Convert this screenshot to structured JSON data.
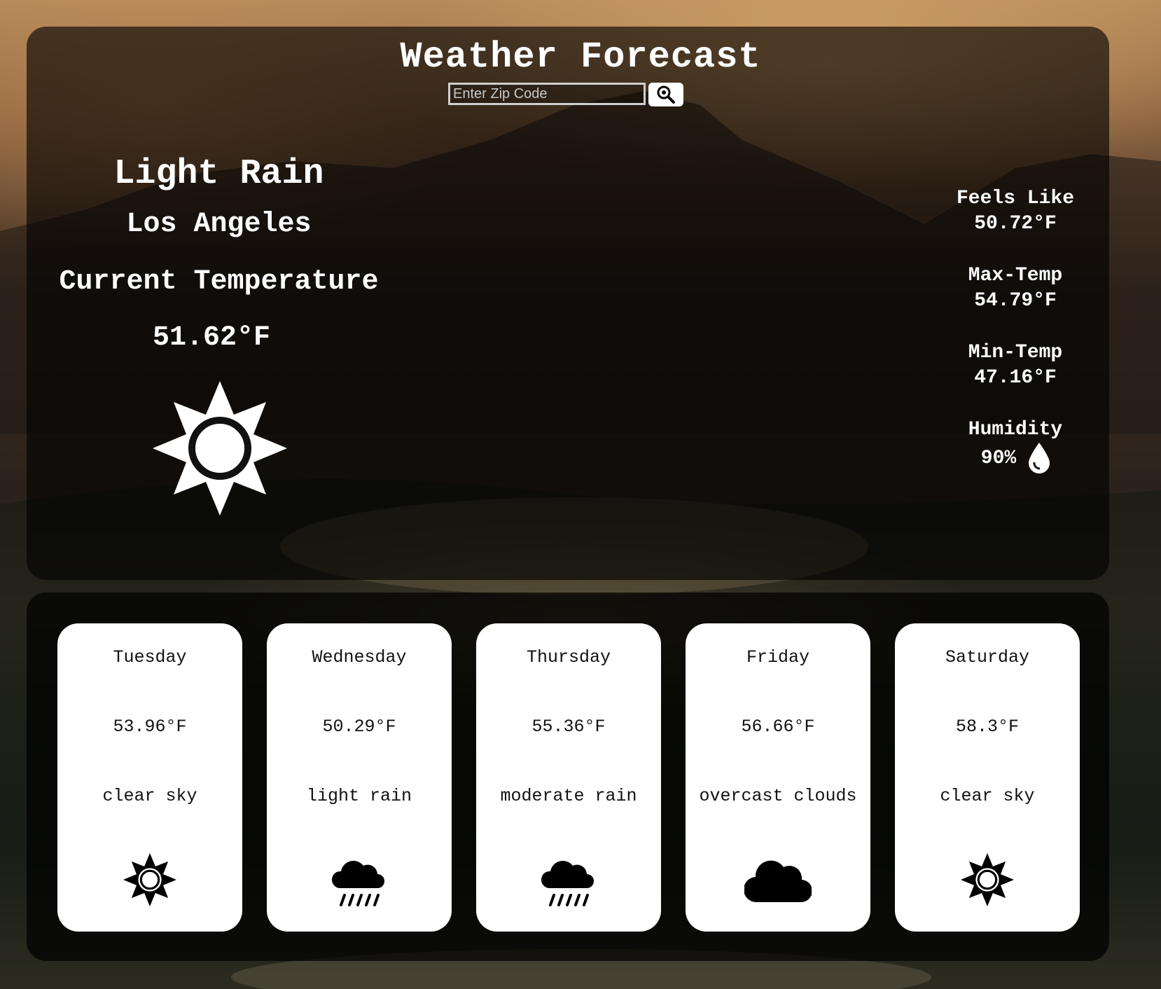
{
  "header": {
    "title": "Weather Forecast",
    "search_placeholder": "Enter Zip Code",
    "search_icon": "magnifier-icon"
  },
  "current": {
    "condition": "Light Rain",
    "city": "Los Angeles",
    "temp_label": "Current Temperature",
    "temp_value": "51.62°F",
    "icon": "sun-icon"
  },
  "stats": {
    "feels_like_label": "Feels Like",
    "feels_like_value": "50.72°F",
    "max_label": "Max-Temp",
    "max_value": "54.79°F",
    "min_label": "Min-Temp",
    "min_value": "47.16°F",
    "humidity_label": "Humidity",
    "humidity_value": "90%",
    "humidity_icon": "water-drop-icon"
  },
  "forecast": [
    {
      "day": "Tuesday",
      "temp": "53.96°F",
      "desc": "clear sky",
      "icon": "sun-icon"
    },
    {
      "day": "Wednesday",
      "temp": "50.29°F",
      "desc": "light rain",
      "icon": "rain-cloud-icon"
    },
    {
      "day": "Thursday",
      "temp": "55.36°F",
      "desc": "moderate rain",
      "icon": "rain-cloud-icon"
    },
    {
      "day": "Friday",
      "temp": "56.66°F",
      "desc": "overcast clouds",
      "icon": "cloud-icon"
    },
    {
      "day": "Saturday",
      "temp": "58.3°F",
      "desc": "clear sky",
      "icon": "sun-icon"
    }
  ],
  "colors": {
    "panel": "#000000",
    "text": "#ffffff",
    "card": "#ffffff"
  }
}
